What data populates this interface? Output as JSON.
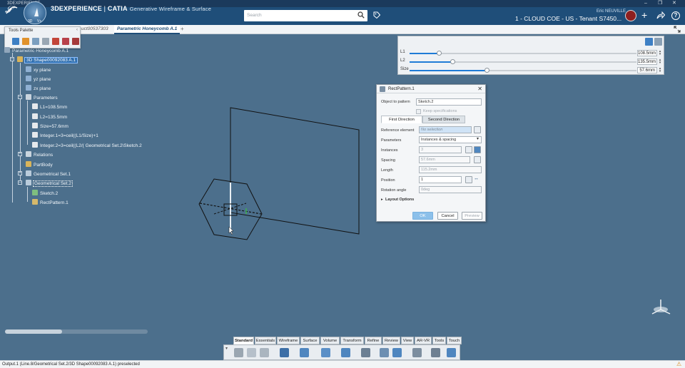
{
  "window": {
    "title": "3DEXPERIENCE"
  },
  "header": {
    "brand_bold": "3DEXPERIENCE",
    "brand_sep": " | ",
    "brand_catia": "CATIA",
    "app_name": "Generative Wireframe & Surface",
    "search_placeholder": "Search",
    "tenant": "1 - CLOUD COE - US - Tenant S7450...",
    "user": "Eric NEUVILLE"
  },
  "tabs": [
    {
      "label": "uct00537303"
    },
    {
      "label": "Parametric Honeycomb A.1"
    }
  ],
  "tools_palette": {
    "title": "Tools Palette"
  },
  "tree": {
    "root": "Parametric Honeycomb A.1",
    "shape": "3D Shape00092083 A.1",
    "xy": "xy plane",
    "yz": "yz plane",
    "zx": "zx plane",
    "parameters": "Parameters",
    "l1": "L1=108.5mm",
    "l2": "L2=135.5mm",
    "size": "Size=57.6mm",
    "int1": "Integer.1=3=ceil((L1/Size)+1",
    "int2": "Integer.2=3=ceil((L2/( Geometrical Set.2\\Sketch.2",
    "relations": "Relations",
    "partbody": "PartBody",
    "geoset1": "Geometrical Set.1",
    "geoset2": "Geometrical Set.2",
    "sketch2": "Sketch.2",
    "rectpattern": "RectPattern.1"
  },
  "sliders": [
    {
      "label": "L1",
      "value": "108.5mm",
      "fraction": 0.13
    },
    {
      "label": "L2",
      "value": "135.5mm",
      "fraction": 0.19
    },
    {
      "label": "Size",
      "value": "57.6mm",
      "fraction": 0.34
    }
  ],
  "dialog": {
    "title": "RectPattern.1",
    "object_label": "Object to pattern",
    "object_value": "Sketch.2",
    "keep_spec": "Keep specifications",
    "tab_first": "First Direction",
    "tab_second": "Second Direction",
    "ref_label": "Reference element",
    "ref_value": "No selection",
    "params_label": "Parameters",
    "params_value": "Instances & spacing",
    "instances_label": "Instances",
    "instances_value": "3",
    "spacing_label": "Spacing",
    "spacing_value": "57.6mm",
    "length_label": "Length",
    "length_value": "115.2mm",
    "position_label": "Position",
    "position_value": "1",
    "rotation_label": "Rotation angle",
    "rotation_value": "0deg",
    "layout": "Layout Options",
    "ok": "OK",
    "cancel": "Cancel",
    "preview": "Preview"
  },
  "section_tabs": [
    "Standard",
    "Essentials",
    "Wireframe",
    "Surface",
    "Volume",
    "Transform",
    "Refine",
    "Review",
    "View",
    "AR-VR",
    "Tools",
    "Touch"
  ],
  "active_section": "Standard",
  "status": {
    "text": "Output.1 (Line.8/Geometrical Set.2/3D Shape00092083 A.1) preselected"
  },
  "colors": {
    "viewport": "#4c6f8c",
    "topbar": "#1f4e79",
    "selection": "#2f6fb0",
    "accent": "#1e7bd6"
  }
}
